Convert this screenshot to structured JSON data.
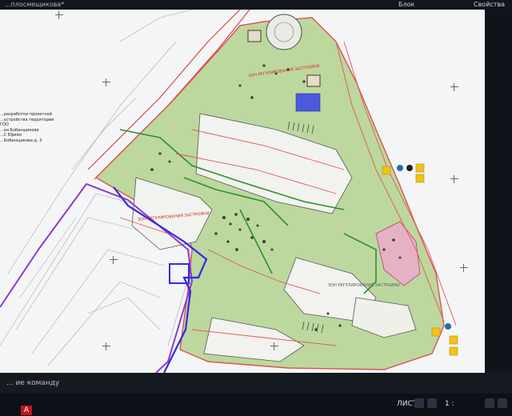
{
  "window": {
    "title": "...плосмещикова*",
    "block_menu": "Блок",
    "properties_menu": "Свойства"
  },
  "drawing": {
    "zone_labels": [
      "ЗОН РЕГУЛИРОВАНИЯ ЗАСТРОЙКИ",
      "ЗОН РЕГУЛИРОВАНИЯ ЗАСТРОЙКИ",
      "ЗОН РЕГУЛИРОВАНИЯ ЗАСТРОЙКИ"
    ],
    "note_lines": [
      "...разработки проектной",
      "...устройства территории ГОО",
      "...ая Бобинщикова",
      "...С Ефимо",
      "...Бобинщикова д. 3"
    ],
    "colors": {
      "canvas": "#f4f5f6",
      "zone_green": "#b9d79a",
      "boundary_red": "#e04a4a",
      "plan_blue": "#3a2be0",
      "district_purple": "#9b37c9",
      "path_green": "#2f8f2f"
    }
  },
  "command_line": {
    "text": "... ие команду"
  },
  "status_bar": {
    "sheet_label": "ЛИСТ",
    "zoom_label": "1 :"
  }
}
